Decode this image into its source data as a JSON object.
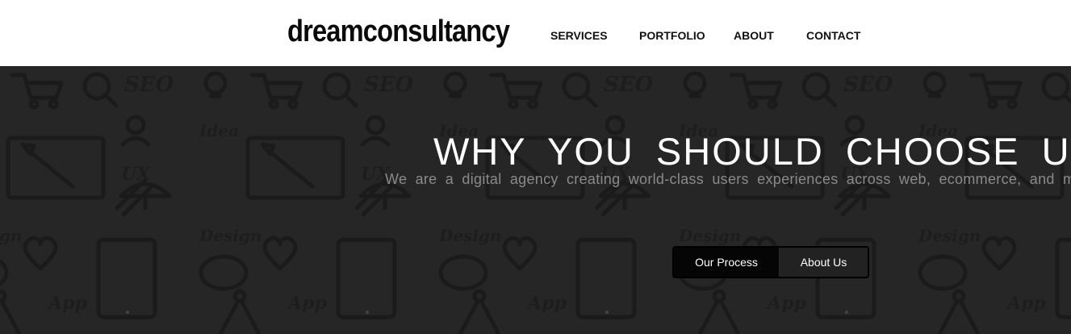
{
  "header": {
    "logo": "dreamconsultancy",
    "nav": [
      {
        "label": "SERVICES"
      },
      {
        "label": "PORTFOLIO"
      },
      {
        "label": "ABOUT"
      },
      {
        "label": "CONTACT"
      }
    ]
  },
  "hero": {
    "title": "WHY YOU SHOULD CHOOSE US",
    "subtitle": "We are a digital agency creating world-class users experiences across web, ecommerce, and mobile",
    "buttons": {
      "primary_label": "Our Process",
      "secondary_label": "About Us"
    },
    "background_color": "#262626",
    "pattern_icon_names": [
      "cart-icon",
      "search-icon",
      "seo-text",
      "lightbulb-icon",
      "idea-text",
      "monitor-pencil-icon",
      "user-icon",
      "ux-text",
      "phone-icon",
      "design-text",
      "heart-icon",
      "tablet-icon",
      "brain-icon",
      "compass-icon",
      "app-text"
    ]
  }
}
